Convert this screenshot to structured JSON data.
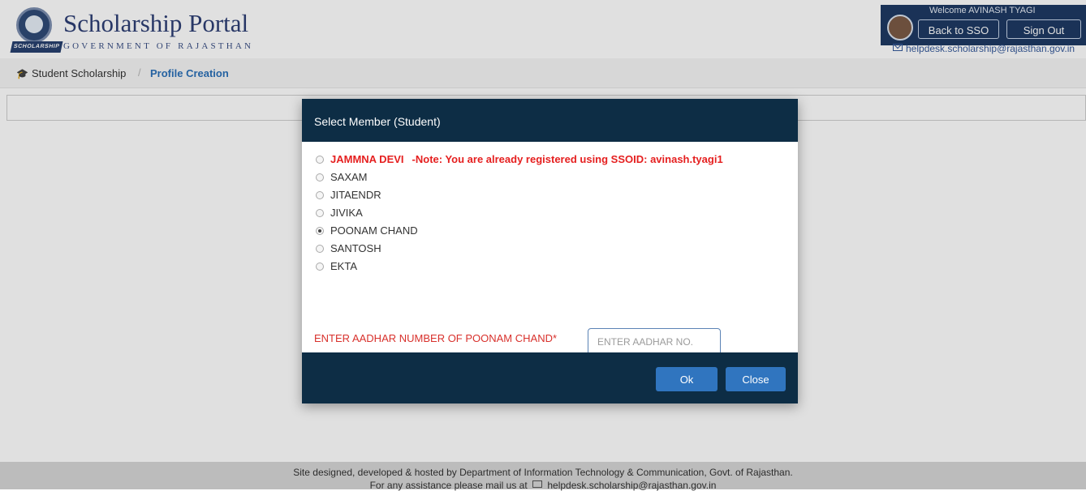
{
  "header": {
    "portal_title": "Scholarship Portal",
    "portal_subtitle": "GOVERNMENT OF RAJASTHAN",
    "emblem_label": "SCHOLARSHIP",
    "welcome": "Welcome AVINASH TYAGI",
    "back_to_sso": "Back to SSO",
    "sign_out": "Sign Out",
    "help_email": "helpdesk.scholarship@rajasthan.gov.in"
  },
  "breadcrumb": {
    "home": "Student Scholarship",
    "separator": "/",
    "current": "Profile Creation"
  },
  "modal": {
    "title": "Select Member (Student)",
    "members": [
      {
        "name": "JAMMNA DEVI",
        "note": "-Note: You are already registered using SSOID:  avinash.tyagi1",
        "selected": false
      },
      {
        "name": "SAXAM",
        "selected": false
      },
      {
        "name": "JITAENDR",
        "selected": false
      },
      {
        "name": "JIVIKA",
        "selected": false
      },
      {
        "name": "POONAM CHAND",
        "selected": true
      },
      {
        "name": "SANTOSH",
        "selected": false
      },
      {
        "name": "EKTA",
        "selected": false
      }
    ],
    "aadhar_label": "ENTER AADHAR NUMBER OF POONAM CHAND*",
    "aadhar_placeholder": "ENTER AADHAR NO.",
    "aadhar_value": "",
    "ok_label": "Ok",
    "close_label": "Close"
  },
  "footer": {
    "line1": "Site designed, developed & hosted by Department of Information Technology & Communication, Govt. of Rajasthan.",
    "line2_prefix": "For any assistance please mail us at",
    "line2_email": "helpdesk.scholarship@rajasthan.gov.in"
  },
  "colors": {
    "header_blue": "#1e3a63",
    "modal_dark": "#0d2d45",
    "button_blue": "#3075bf",
    "warning_red": "#e51f1f",
    "link_blue": "#2b70b8"
  }
}
